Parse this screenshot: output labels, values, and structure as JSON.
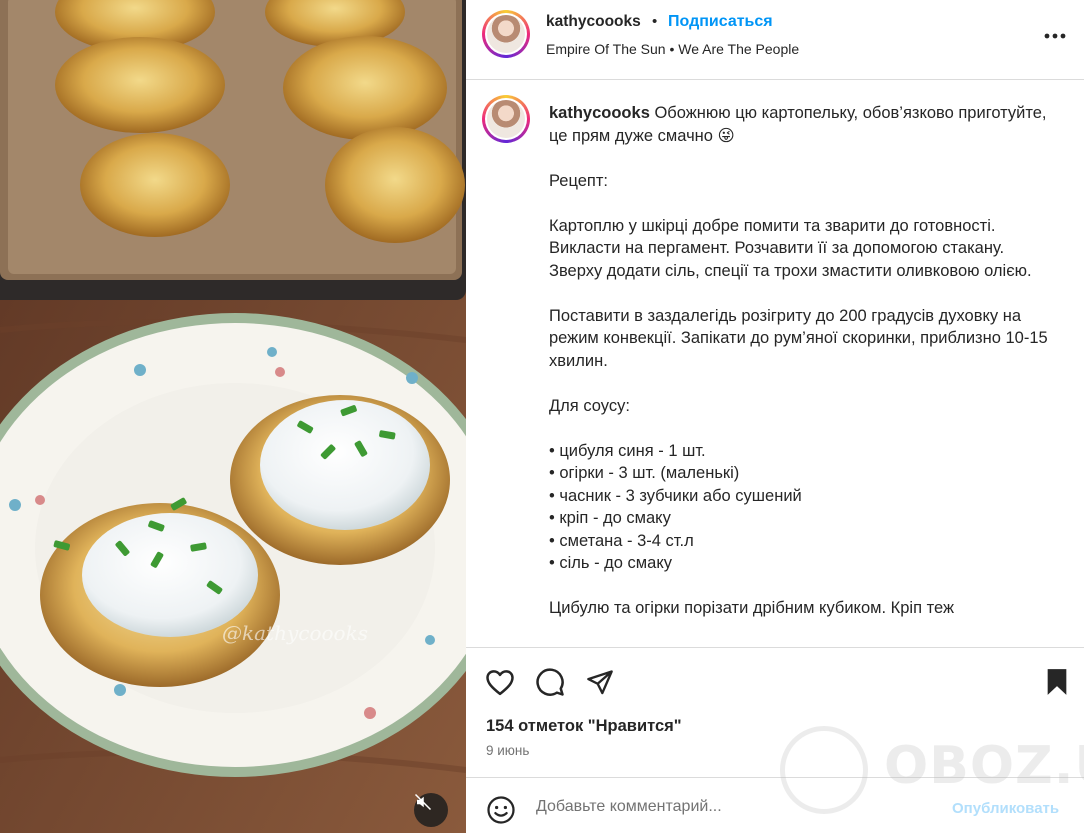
{
  "post": {
    "username": "kathycoooks",
    "separator": "•",
    "follow_label": "Подписаться",
    "audio": "Empire Of The Sun • We Are The People",
    "media_watermark": "@kathycoooks"
  },
  "caption": {
    "username": "kathycoooks",
    "text": " Обожнюю цю картопельку, обов’язково приготуйте, це прям дуже смачно 😜\n\nРецепт:\n\nКартоплю у шкірці добре помити та зварити до готовності. Викласти на пергамент. Розчавити її за допомогою стакану. Зверху додати сіль, спеції та трохи змастити оливковою олією.\n\nПоставити в заздалегідь розігриту до 200 градусів духовку на режим конвекції. Запікати до рум’яної скоринки, приблизно 10-15 хвилин.\n\nДля соусу:\n\n• цибуля синя - 1 шт.\n• огірки - 3 шт. (маленькі)\n• часник - 3 зубчики або сушений\n• кріп - до смаку\n• сметана - 3-4 ст.л\n• сіль - до смаку\n\nЦибулю та огірки порізати дрібним кубиком. Кріп теж"
  },
  "stats": {
    "likes": "154 отметок \"Нравится\"",
    "date": "9 июнь"
  },
  "comment": {
    "placeholder": "Добавьте комментарий...",
    "post_label": "Опубликовать"
  },
  "site_watermark": "OBOZ.UA",
  "icons": {
    "like": "heart-icon",
    "comment": "comment-bubble-icon",
    "share": "paper-plane-icon",
    "save": "bookmark-icon",
    "more": "more-dots-icon",
    "mute": "speaker-muted-icon",
    "emoji": "smiley-icon"
  },
  "colors": {
    "follow": "#0095f6",
    "post_disabled": "#b2dffc",
    "text": "#262626",
    "muted": "#737373"
  }
}
